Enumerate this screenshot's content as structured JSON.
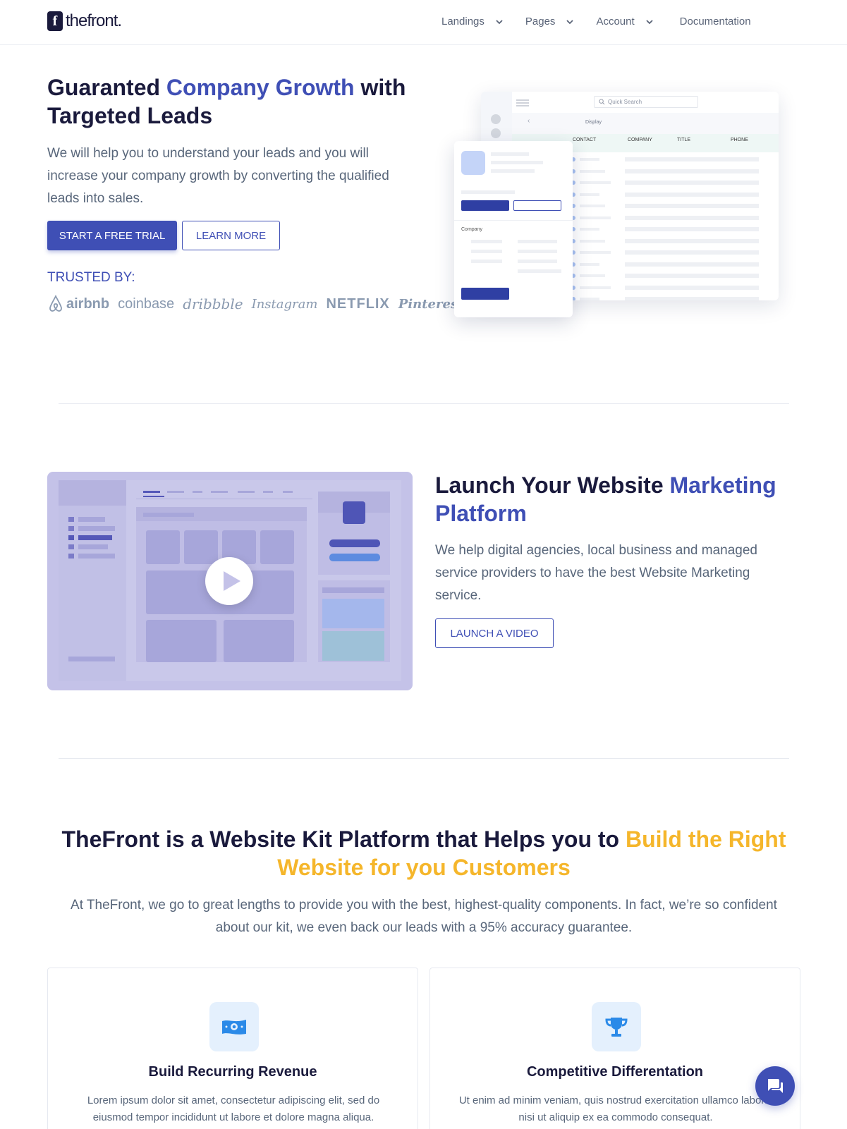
{
  "header": {
    "logo_mark": "f",
    "logo_text": "thefront.",
    "nav": [
      {
        "label": "Landings"
      },
      {
        "label": "Pages"
      },
      {
        "label": "Account"
      },
      {
        "label": "Documentation"
      }
    ]
  },
  "hero": {
    "title_1": "Guaranted ",
    "title_accent": "Company Growth",
    "title_2": " with Targeted Leads",
    "text": "We will help you to understand your leads and you will increase your company growth by converting the qualified leads into sales.",
    "primary_cta": "START A FREE TRIAL",
    "secondary_cta": "LEARN MORE",
    "trusted_label": "TRUSTED BY:",
    "brands": [
      "airbnb",
      "coinbase",
      "dribbble",
      "Instagram",
      "NETFLIX",
      "Pinterest"
    ]
  },
  "dashboard": {
    "search_placeholder": "Quick Search",
    "display_label": "Display",
    "columns": [
      "CONTACT",
      "COMPANY",
      "TITLE",
      "PHONE"
    ],
    "card_section_label": "Company"
  },
  "marketing": {
    "title_1": "Launch Your Website ",
    "title_accent": "Marketing Platform",
    "text": "We help digital agencies, local business and managed service providers to have the best Website Marketing service.",
    "cta": "LAUNCH A VIDEO"
  },
  "kit": {
    "title_1": "TheFront is a Website Kit Platform that Helps you to ",
    "title_accent": "Build the Right Website for you Customers",
    "text": "At TheFront, we go to great lengths to provide you with the best, highest-quality components. In fact, we’re so confident about our kit, we even back our leads with a 95% accuracy guarantee.",
    "features": [
      {
        "icon": "money-icon",
        "title": "Build Recurring Revenue",
        "text": "Lorem ipsum dolor sit amet, consectetur adipiscing elit, sed do eiusmod tempor incididunt ut labore et dolore magna aliqua."
      },
      {
        "icon": "trophy-icon",
        "title": "Competitive Differentation",
        "text": "Ut enim ad minim veniam, quis nostrud exercitation ullamco laboris nisi ut aliquip ex ea commodo consequat."
      }
    ]
  },
  "colors": {
    "primary": "#3f4fb5",
    "accent_gold": "#f5b62b",
    "heading": "#1a1a3c",
    "body_text": "#58667a",
    "video_bg": "#c4c2e8"
  }
}
